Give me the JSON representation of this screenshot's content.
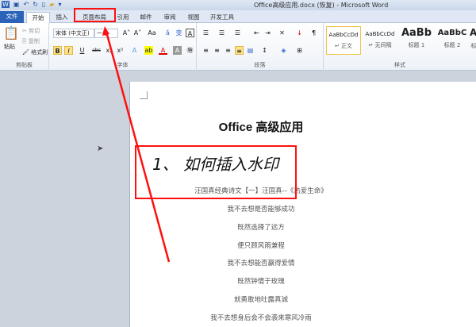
{
  "window": {
    "title": "Office高级应用.docx (恢复) - Microsoft Word"
  },
  "tabs": [
    "文件",
    "开始",
    "插入",
    "页面布局",
    "引用",
    "邮件",
    "审阅",
    "视图",
    "开发工具"
  ],
  "active_tab": "开始",
  "clipboard": {
    "paste": "粘贴",
    "cut": "剪切",
    "copy": "复制",
    "format_painter": "格式刷",
    "label": "剪贴板"
  },
  "font": {
    "name": "宋体 (中文正)",
    "size": "一号",
    "label": "字体",
    "bold": "B",
    "italic": "I",
    "underline": "U",
    "strike": "abc"
  },
  "paragraph": {
    "label": "段落"
  },
  "styles": {
    "label": "样式",
    "items": [
      {
        "sample": "AaBbCcDd",
        "name": "↵ 正文"
      },
      {
        "sample": "AaBbCcDd",
        "name": "↵ 无间隔"
      },
      {
        "sample": "AaBb",
        "name": "标题 1"
      },
      {
        "sample": "AaBbC",
        "name": "标题 2"
      },
      {
        "sample": "AaI",
        "name": "标"
      }
    ]
  },
  "document": {
    "title": "Office 高级应用",
    "heading": "1、 如何插入水印",
    "lines": [
      "汪国真经典诗文【一】汪国真--《热爱生命》",
      "我不去想是否能够成功",
      "既然选择了远方",
      "便只顾风雨兼程",
      "我不去想能否赢得爱情",
      "既然钟情于玫瑰",
      "就勇敢地吐露真诚",
      "我不去想身后会不会袭来寒风冷雨"
    ]
  },
  "annotation_color": "#ff1010"
}
